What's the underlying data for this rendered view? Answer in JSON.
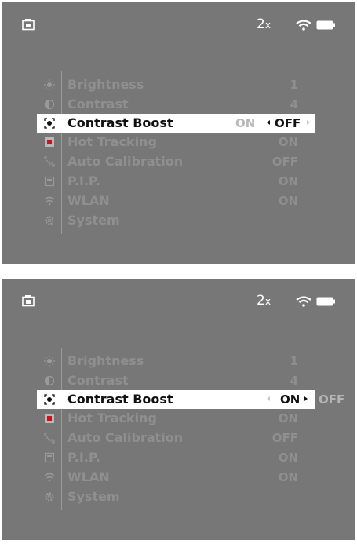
{
  "screens": [
    {
      "status": {
        "zoom": "2",
        "zoom_unit": "x"
      },
      "menu": [
        {
          "icon": "brightness-icon",
          "label": "Brightness",
          "value": "1"
        },
        {
          "icon": "contrast-icon",
          "label": "Contrast",
          "value": "4"
        },
        {
          "icon": "contrast-boost-icon",
          "label": "Contrast Boost",
          "options": {
            "prev": "ON",
            "current": "OFF",
            "next": ""
          }
        },
        {
          "icon": "hot-tracking-icon",
          "label": "Hot Tracking",
          "value": "ON"
        },
        {
          "icon": "auto-calibration-icon",
          "label": "Auto Calibration",
          "value": "OFF"
        },
        {
          "icon": "pip-icon",
          "label": "P.I.P.",
          "value": "ON"
        },
        {
          "icon": "wlan-icon",
          "label": "WLAN",
          "value": "ON"
        },
        {
          "icon": "system-icon",
          "label": "System",
          "value": ""
        }
      ]
    },
    {
      "status": {
        "zoom": "2",
        "zoom_unit": "x"
      },
      "menu": [
        {
          "icon": "brightness-icon",
          "label": "Brightness",
          "value": "1"
        },
        {
          "icon": "contrast-icon",
          "label": "Contrast",
          "value": "4"
        },
        {
          "icon": "contrast-boost-icon",
          "label": "Contrast Boost",
          "options": {
            "prev": "",
            "current": "ON",
            "next": "OFF"
          }
        },
        {
          "icon": "hot-tracking-icon",
          "label": "Hot Tracking",
          "value": "ON"
        },
        {
          "icon": "auto-calibration-icon",
          "label": "Auto Calibration",
          "value": "OFF"
        },
        {
          "icon": "pip-icon",
          "label": "P.I.P.",
          "value": "ON"
        },
        {
          "icon": "wlan-icon",
          "label": "WLAN",
          "value": "ON"
        },
        {
          "icon": "system-icon",
          "label": "System",
          "value": ""
        }
      ]
    }
  ]
}
